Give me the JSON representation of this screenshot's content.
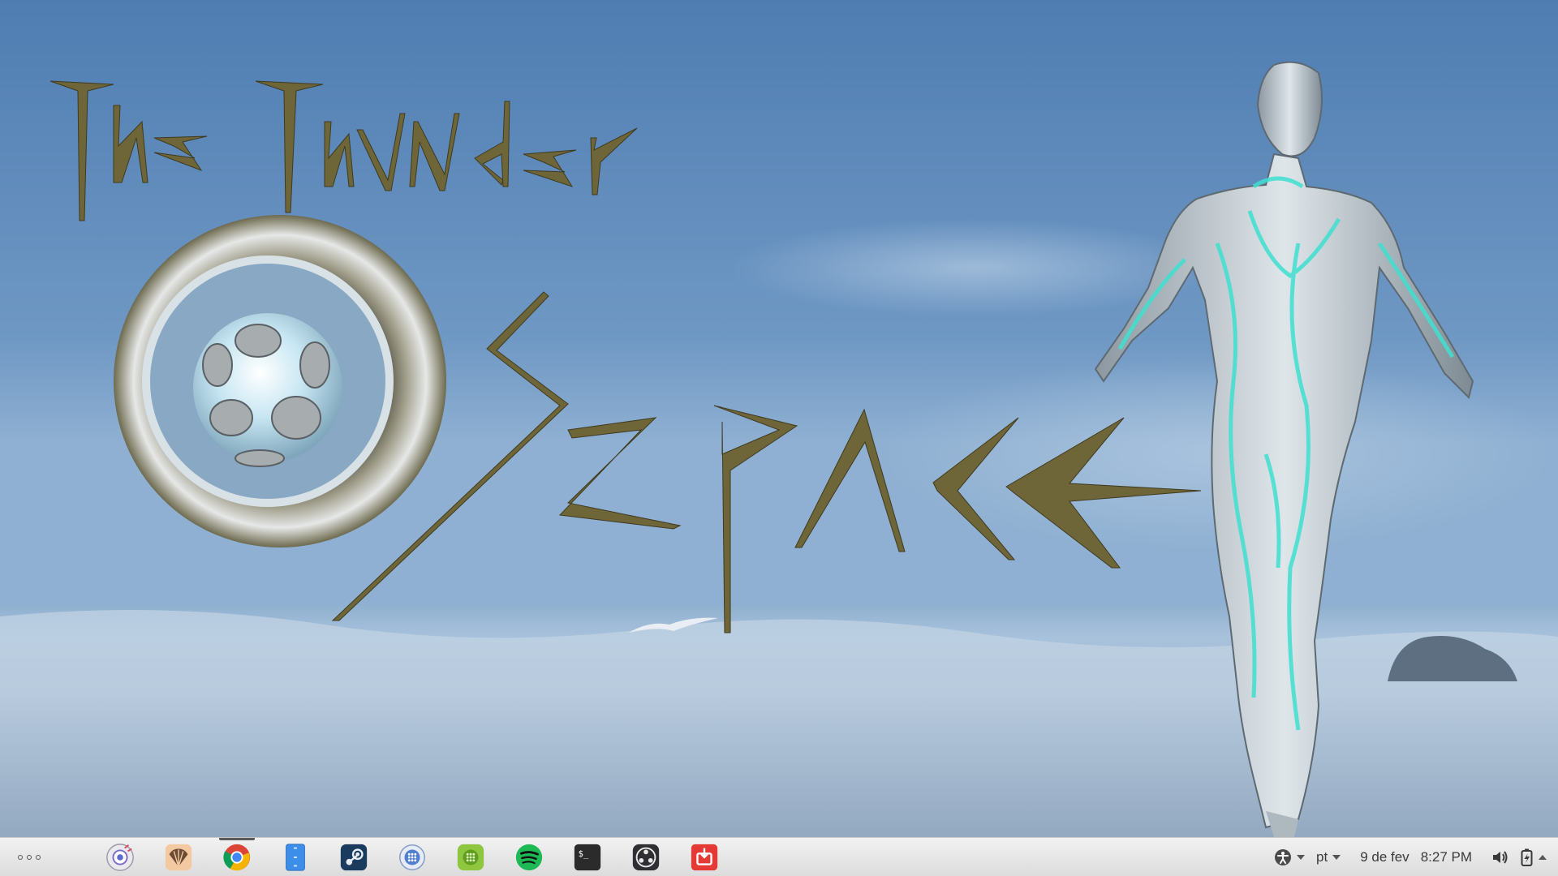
{
  "wallpaper": {
    "title_line1": "The Thunder",
    "title_line2": "Space",
    "sky_color": "#5a86b8",
    "sea_color": "#9db8d4",
    "text_color": "#6e6538",
    "figure_glow": "#3fe0d0"
  },
  "taskbar": {
    "launcher_icon": "app-grid-dots-icon",
    "dock": [
      {
        "id": "screenshot",
        "icon": "screenshot-tool-icon",
        "active": false
      },
      {
        "id": "shell",
        "icon": "seashell-icon",
        "active": false
      },
      {
        "id": "chrome",
        "icon": "chrome-icon",
        "active": true
      },
      {
        "id": "files",
        "icon": "file-manager-icon",
        "active": false
      },
      {
        "id": "steam",
        "icon": "steam-icon",
        "active": false
      },
      {
        "id": "appcenter",
        "icon": "app-center-icon",
        "active": false
      },
      {
        "id": "greenapp",
        "icon": "green-grid-app-icon",
        "active": false
      },
      {
        "id": "spotify",
        "icon": "spotify-icon",
        "active": false
      },
      {
        "id": "terminal",
        "icon": "terminal-icon",
        "active": false
      },
      {
        "id": "obs",
        "icon": "obs-icon",
        "active": false
      },
      {
        "id": "redapp",
        "icon": "red-inbox-app-icon",
        "active": false
      }
    ],
    "terminal_glyph": "$_",
    "tray": {
      "accessibility_icon": "accessibility-icon",
      "keyboard_layout": "pt",
      "date": "9 de fev",
      "time": "8:27 PM",
      "volume_icon": "speaker-icon",
      "power_icon": "battery-charging-icon"
    }
  }
}
